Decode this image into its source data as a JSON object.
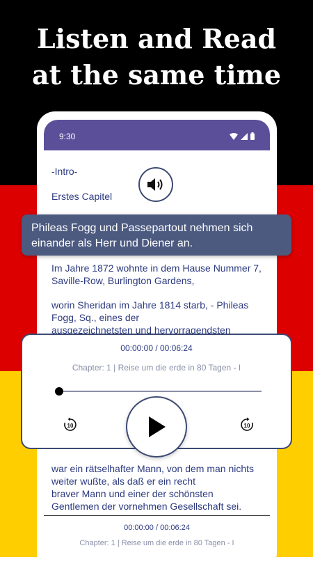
{
  "promo": {
    "headline_line1": "Listen and Read",
    "headline_line2": "at the same time"
  },
  "status_bar": {
    "time": "9:30",
    "icons": [
      "wifi-icon",
      "signal-icon",
      "battery-icon"
    ]
  },
  "reader": {
    "intro": "-Intro-",
    "chapter_heading": "Erstes Capitel",
    "paragraph1_line1": "Im Jahre 1872 wohnte in dem Hause Nummer 7,",
    "paragraph1_line2": "Saville-Row, Burlington Gardens,",
    "paragraph2_line1": "worin Sheridan im Jahre 1814 starb, - Phileas",
    "paragraph2_line2": "Fogg, Sq., eines der",
    "paragraph2_line3": "ausgezeichnetsten und hervorragendsten",
    "paragraph3_line1": "war ein rätselhafter Mann, von dem man nichts",
    "paragraph3_line2": "weiter wußte, als daß er ein recht",
    "paragraph3_line3": "braver Mann und einer der schönsten",
    "paragraph3_line4": "Gentlemen der vornehmen Gesellschaft sei."
  },
  "tooltip": {
    "line1": "Phileas Fogg und Passepartout nehmen sich",
    "line2": "einander als Herr und Diener an."
  },
  "player": {
    "time": "00:00:00 / 00:06:24",
    "chapter": "Chapter: 1 | Reise um die erde in 80 Tagen - I",
    "progress": 0.0,
    "rewind_seconds": "10",
    "forward_seconds": "10"
  },
  "mini_player": {
    "time": "00:00:00 / 00:06:24",
    "chapter": "Chapter: 1 | Reise um die erde in 80 Tagen - I"
  },
  "colors": {
    "flag_black": "#000000",
    "flag_red": "#DD0000",
    "flag_gold": "#FFCE00",
    "status_bar": "#5B4F9A",
    "text_accent": "#2C3A80",
    "tooltip_bg": "#4C5A80"
  }
}
